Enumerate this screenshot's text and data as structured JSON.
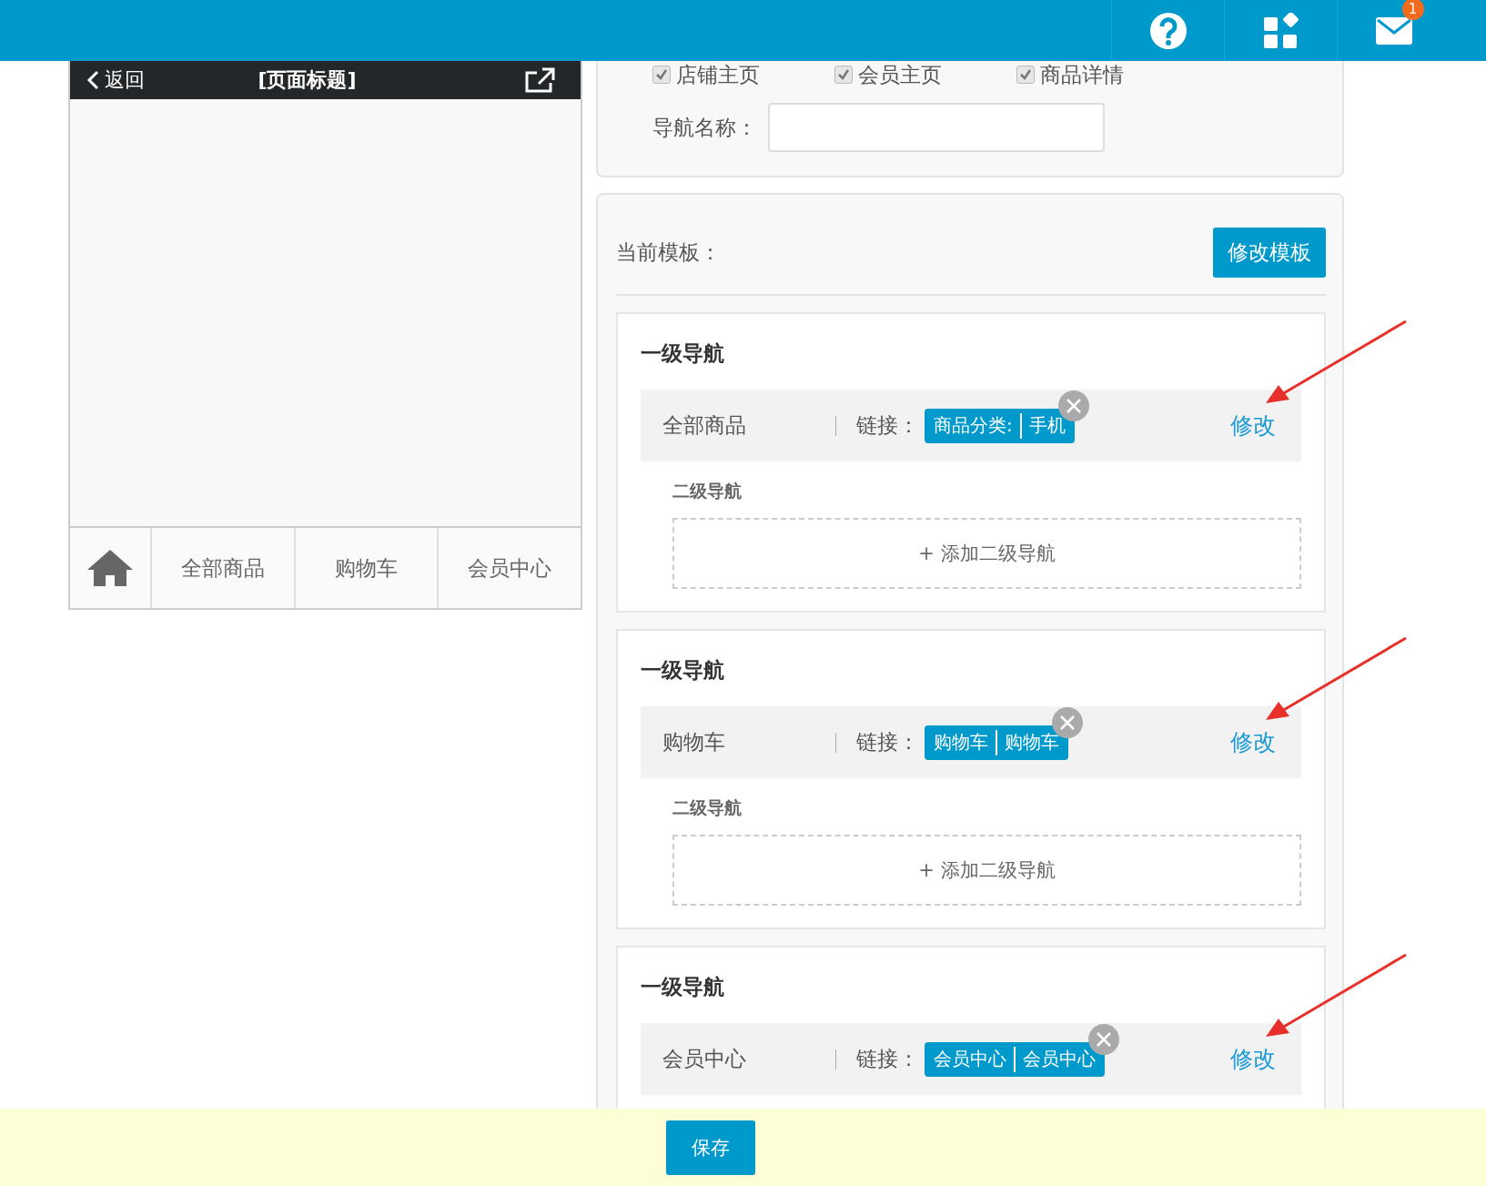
{
  "top_bar": {
    "icons": [
      {
        "kind": "help"
      },
      {
        "kind": "apps"
      },
      {
        "kind": "mail",
        "badge": "1"
      }
    ]
  },
  "phone": {
    "back": "返回",
    "title": "[页面标题]",
    "tabs": [
      "全部商品",
      "购物车",
      "会员中心"
    ]
  },
  "page_options": {
    "checkboxes": [
      {
        "label": "店铺主页",
        "checked": true
      },
      {
        "label": "会员主页",
        "checked": true
      },
      {
        "label": "商品详情",
        "checked": true
      }
    ],
    "nav_name_label": "导航名称："
  },
  "template": {
    "label": "当前模板：",
    "button": "修改模板"
  },
  "sections": [
    {
      "title": "一级导航",
      "name": "全部商品",
      "link_label": "链接：",
      "link_parts": [
        "商品分类:",
        "手机"
      ],
      "edit": "修改",
      "sub_title": "二级导航",
      "add": "+ 添加二级导航"
    },
    {
      "title": "一级导航",
      "name": "购物车",
      "link_label": "链接：",
      "link_parts": [
        "购物车",
        "购物车"
      ],
      "edit": "修改",
      "sub_title": "二级导航",
      "add": "+ 添加二级导航"
    },
    {
      "title": "一级导航",
      "name": "会员中心",
      "link_label": "链接：",
      "link_parts": [
        "会员中心",
        "会员中心"
      ],
      "edit": "修改"
    }
  ],
  "save_button": "保存"
}
